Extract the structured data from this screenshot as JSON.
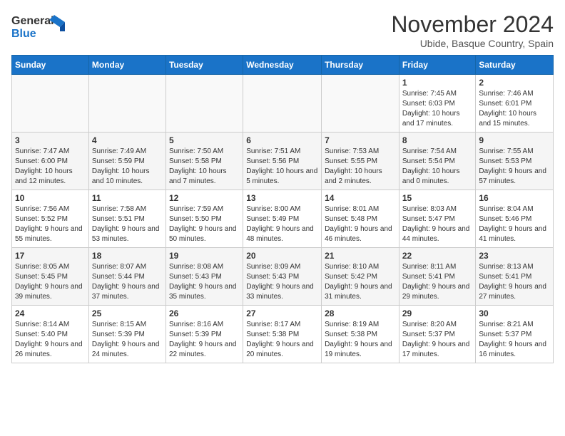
{
  "logo": {
    "line1": "General",
    "line2": "Blue"
  },
  "title": "November 2024",
  "subtitle": "Ubide, Basque Country, Spain",
  "days_of_week": [
    "Sunday",
    "Monday",
    "Tuesday",
    "Wednesday",
    "Thursday",
    "Friday",
    "Saturday"
  ],
  "weeks": [
    [
      {
        "day": "",
        "info": ""
      },
      {
        "day": "",
        "info": ""
      },
      {
        "day": "",
        "info": ""
      },
      {
        "day": "",
        "info": ""
      },
      {
        "day": "",
        "info": ""
      },
      {
        "day": "1",
        "info": "Sunrise: 7:45 AM\nSunset: 6:03 PM\nDaylight: 10 hours and 17 minutes."
      },
      {
        "day": "2",
        "info": "Sunrise: 7:46 AM\nSunset: 6:01 PM\nDaylight: 10 hours and 15 minutes."
      }
    ],
    [
      {
        "day": "3",
        "info": "Sunrise: 7:47 AM\nSunset: 6:00 PM\nDaylight: 10 hours and 12 minutes."
      },
      {
        "day": "4",
        "info": "Sunrise: 7:49 AM\nSunset: 5:59 PM\nDaylight: 10 hours and 10 minutes."
      },
      {
        "day": "5",
        "info": "Sunrise: 7:50 AM\nSunset: 5:58 PM\nDaylight: 10 hours and 7 minutes."
      },
      {
        "day": "6",
        "info": "Sunrise: 7:51 AM\nSunset: 5:56 PM\nDaylight: 10 hours and 5 minutes."
      },
      {
        "day": "7",
        "info": "Sunrise: 7:53 AM\nSunset: 5:55 PM\nDaylight: 10 hours and 2 minutes."
      },
      {
        "day": "8",
        "info": "Sunrise: 7:54 AM\nSunset: 5:54 PM\nDaylight: 10 hours and 0 minutes."
      },
      {
        "day": "9",
        "info": "Sunrise: 7:55 AM\nSunset: 5:53 PM\nDaylight: 9 hours and 57 minutes."
      }
    ],
    [
      {
        "day": "10",
        "info": "Sunrise: 7:56 AM\nSunset: 5:52 PM\nDaylight: 9 hours and 55 minutes."
      },
      {
        "day": "11",
        "info": "Sunrise: 7:58 AM\nSunset: 5:51 PM\nDaylight: 9 hours and 53 minutes."
      },
      {
        "day": "12",
        "info": "Sunrise: 7:59 AM\nSunset: 5:50 PM\nDaylight: 9 hours and 50 minutes."
      },
      {
        "day": "13",
        "info": "Sunrise: 8:00 AM\nSunset: 5:49 PM\nDaylight: 9 hours and 48 minutes."
      },
      {
        "day": "14",
        "info": "Sunrise: 8:01 AM\nSunset: 5:48 PM\nDaylight: 9 hours and 46 minutes."
      },
      {
        "day": "15",
        "info": "Sunrise: 8:03 AM\nSunset: 5:47 PM\nDaylight: 9 hours and 44 minutes."
      },
      {
        "day": "16",
        "info": "Sunrise: 8:04 AM\nSunset: 5:46 PM\nDaylight: 9 hours and 41 minutes."
      }
    ],
    [
      {
        "day": "17",
        "info": "Sunrise: 8:05 AM\nSunset: 5:45 PM\nDaylight: 9 hours and 39 minutes."
      },
      {
        "day": "18",
        "info": "Sunrise: 8:07 AM\nSunset: 5:44 PM\nDaylight: 9 hours and 37 minutes."
      },
      {
        "day": "19",
        "info": "Sunrise: 8:08 AM\nSunset: 5:43 PM\nDaylight: 9 hours and 35 minutes."
      },
      {
        "day": "20",
        "info": "Sunrise: 8:09 AM\nSunset: 5:43 PM\nDaylight: 9 hours and 33 minutes."
      },
      {
        "day": "21",
        "info": "Sunrise: 8:10 AM\nSunset: 5:42 PM\nDaylight: 9 hours and 31 minutes."
      },
      {
        "day": "22",
        "info": "Sunrise: 8:11 AM\nSunset: 5:41 PM\nDaylight: 9 hours and 29 minutes."
      },
      {
        "day": "23",
        "info": "Sunrise: 8:13 AM\nSunset: 5:41 PM\nDaylight: 9 hours and 27 minutes."
      }
    ],
    [
      {
        "day": "24",
        "info": "Sunrise: 8:14 AM\nSunset: 5:40 PM\nDaylight: 9 hours and 26 minutes."
      },
      {
        "day": "25",
        "info": "Sunrise: 8:15 AM\nSunset: 5:39 PM\nDaylight: 9 hours and 24 minutes."
      },
      {
        "day": "26",
        "info": "Sunrise: 8:16 AM\nSunset: 5:39 PM\nDaylight: 9 hours and 22 minutes."
      },
      {
        "day": "27",
        "info": "Sunrise: 8:17 AM\nSunset: 5:38 PM\nDaylight: 9 hours and 20 minutes."
      },
      {
        "day": "28",
        "info": "Sunrise: 8:19 AM\nSunset: 5:38 PM\nDaylight: 9 hours and 19 minutes."
      },
      {
        "day": "29",
        "info": "Sunrise: 8:20 AM\nSunset: 5:37 PM\nDaylight: 9 hours and 17 minutes."
      },
      {
        "day": "30",
        "info": "Sunrise: 8:21 AM\nSunset: 5:37 PM\nDaylight: 9 hours and 16 minutes."
      }
    ]
  ]
}
